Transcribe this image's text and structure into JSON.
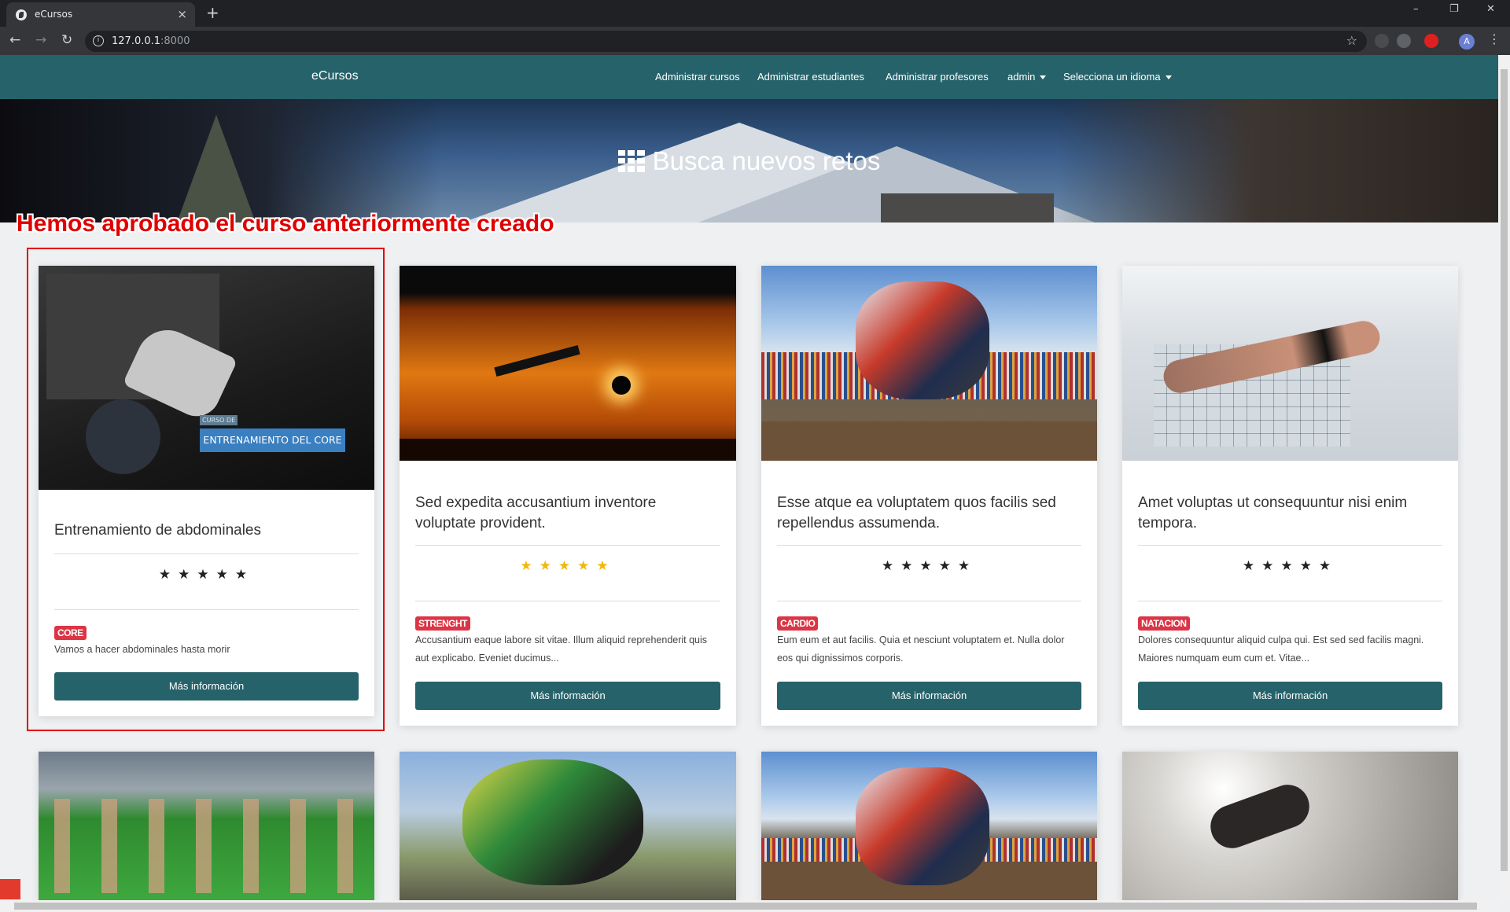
{
  "browser": {
    "tab_title": "eCursos",
    "tab_close": "×",
    "new_tab": "+",
    "url_host": "127.0.0.1",
    "url_port": ":8000",
    "profile_initial": "A",
    "window_controls": [
      "–",
      "❐",
      "✕"
    ]
  },
  "nav": {
    "brand": "eCursos",
    "links": [
      "Administrar cursos",
      "Administrar estudiantes",
      "Administrar profesores",
      "admin",
      "Selecciona un idioma"
    ]
  },
  "hero": {
    "title": "Busca nuevos retos"
  },
  "annotation": "Hemos aprobado el curso anteriormente creado",
  "courses": [
    {
      "title": "Entrenamiento de abdominales",
      "rating_stars": "★★★★★",
      "stars_color": "#222222",
      "category": "CORE",
      "description": "Vamos a hacer abdominales hasta morir",
      "button": "Más información",
      "image_tag_small": "CURSO DE",
      "image_tag_main": "ENTRENAMIENTO DEL CORE"
    },
    {
      "title": "Sed expedita accusantium inventore voluptate provident.",
      "rating_stars": "★★★★★",
      "stars_color": "#f1b80a",
      "category": "STRENGHT",
      "description": "Accusantium eaque labore sit vitae. Illum aliquid reprehenderit quis aut explicabo. Eveniet ducimus...",
      "button": "Más información"
    },
    {
      "title": "Esse atque ea voluptatem quos facilis sed repellendus assumenda.",
      "rating_stars": "★★★★★",
      "stars_color": "#222222",
      "category": "CARDIO",
      "description": "Eum eum et aut facilis. Quia et nesciunt voluptatem et. Nulla dolor eos qui dignissimos corporis.",
      "button": "Más información"
    },
    {
      "title": "Amet voluptas ut consequuntur nisi enim tempora.",
      "rating_stars": "★★★★★",
      "stars_color": "#222222",
      "category": "NATACION",
      "description": "Dolores consequuntur aliquid culpa qui. Est sed sed facilis magni. Maiores numquam eum cum et. Vitae...",
      "button": "Más información"
    }
  ],
  "colors": {
    "navbar": "#26626a",
    "button": "#26626a",
    "badge": "#dc3545",
    "annotation": "#e00000"
  },
  "icons": [
    "globe-icon",
    "back-arrow-icon",
    "forward-arrow-icon",
    "reload-icon",
    "info-icon",
    "star-bookmark-icon",
    "grid-icon",
    "caret-down-icon",
    "kebab-menu-icon"
  ]
}
